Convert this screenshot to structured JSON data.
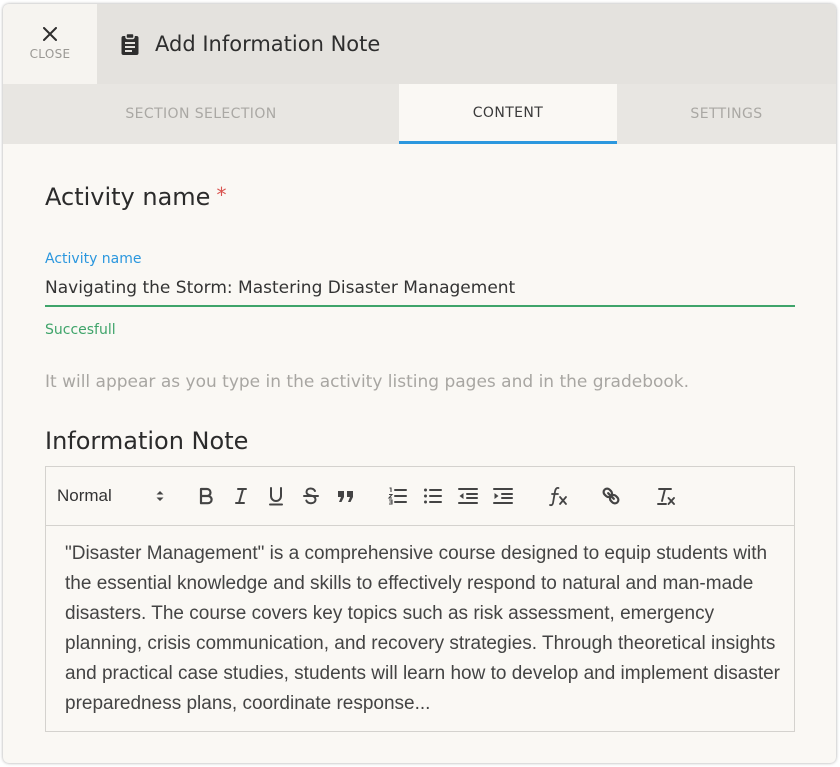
{
  "dialog": {
    "close_label": "CLOSE",
    "title": "Add Information Note",
    "title_icon": "clipboard-icon"
  },
  "tabs": [
    {
      "label": "SECTION SELECTION",
      "active": false
    },
    {
      "label": "CONTENT",
      "active": true
    },
    {
      "label": "SETTINGS",
      "active": false
    }
  ],
  "activity": {
    "heading": "Activity name",
    "required_mark": "*",
    "field_label": "Activity name",
    "field_value": "Navigating the Storm: Mastering Disaster Management",
    "status": "Succesfull",
    "hint": "It will appear as you type in the activity listing pages and in the gradebook."
  },
  "info_note": {
    "heading": "Information Note",
    "format_select": "Normal",
    "toolbar_icons": [
      "bold-icon",
      "italic-icon",
      "underline-icon",
      "strikethrough-icon",
      "blockquote-icon",
      "ordered-list-icon",
      "bullet-list-icon",
      "outdent-icon",
      "indent-icon",
      "formula-icon",
      "link-icon",
      "clear-format-icon"
    ],
    "body": "\"Disaster Management\" is a comprehensive course designed to equip students with the essential knowledge and skills to effectively respond to natural and man-made disasters. The course covers key topics such as risk assessment, emergency planning, crisis communication, and recovery strategies. Through theoretical insights and practical case studies, students will learn how to develop and implement disaster preparedness plans, coordinate response..."
  },
  "colors": {
    "accent": "#2b97de",
    "success": "#3fa46a",
    "required": "#d9534f"
  }
}
